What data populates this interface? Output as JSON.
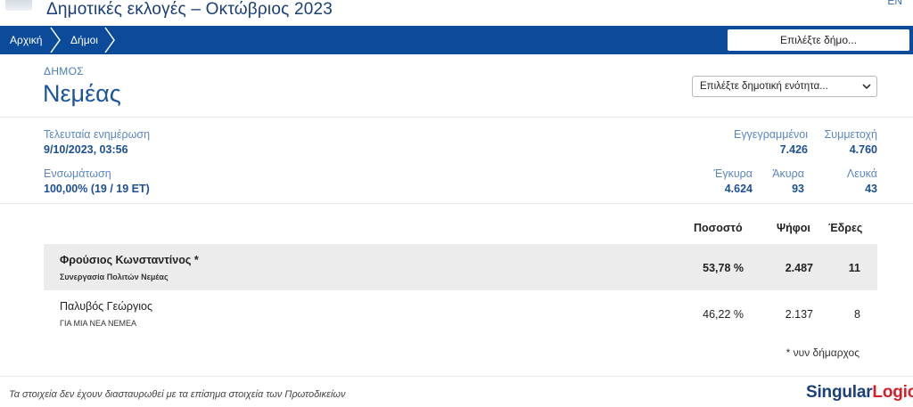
{
  "header": {
    "title": "Δημοτικές εκλογές – Οκτώβριος 2023",
    "language": "EN"
  },
  "nav": {
    "breadcrumbs": [
      "Αρχική",
      "Δήμοι"
    ],
    "municipality_select_placeholder": "Επιλέξτε δήμο..."
  },
  "municipality": {
    "label": "ΔΗΜΟΣ",
    "name": "Νεμέας",
    "unit_select_placeholder": "Επιλέξτε δημοτική ενότητα..."
  },
  "stats": {
    "last_update_label": "Τελευταία ενημέρωση",
    "last_update_value": "9/10/2023, 03:56",
    "integration_label": "Ενσωμάτωση",
    "integration_value": "100,00% (19 / 19 ΕΤ)",
    "registered_label": "Εγγεγραμμένοι",
    "registered_value": "7.426",
    "turnout_label": "Συμμετοχή",
    "turnout_value": "4.760",
    "valid_label": "Έγκυρα",
    "valid_value": "4.624",
    "invalid_label": "Άκυρα",
    "invalid_value": "93",
    "blank_label": "Λευκά",
    "blank_value": "43"
  },
  "results": {
    "headers": {
      "percent": "Ποσοστό",
      "votes": "Ψήφοι",
      "seats": "Έδρες"
    },
    "rows": [
      {
        "candidate": "Φρούσιος Κωνσταντίνος *",
        "party": "Συνεργασία Πολιτών Νεμέας",
        "percent": "53,78 %",
        "votes": "2.487",
        "seats": "11"
      },
      {
        "candidate": "Παλυβός Γεώργιος",
        "party": "ΓΙΑ ΜΙΑ ΝΕΑ ΝΕΜΕΑ",
        "percent": "46,22 %",
        "votes": "2.137",
        "seats": "8"
      }
    ],
    "note": "* νυν δήμαρχος"
  },
  "footer": {
    "disclaimer": "Τα στοιχεία δεν έχουν διασταυρωθεί με τα επίσημα στοιχεία των Πρωτοδικείων",
    "brand_part1": "Singular",
    "brand_part2": "Logic",
    "brand_accent_color": "#d2202a",
    "brand_color": "#1b3f7a"
  },
  "colors": {
    "navbar": "#0b4b9a",
    "title": "#1a3f78",
    "highlight_row": "#ececec"
  }
}
